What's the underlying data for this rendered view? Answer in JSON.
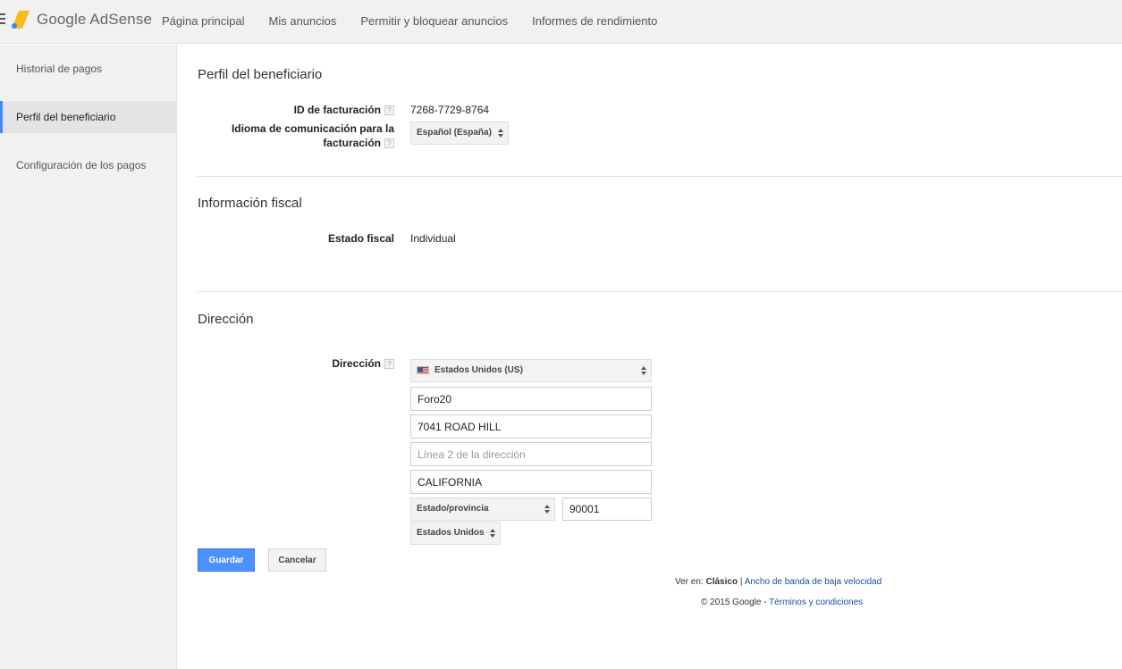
{
  "app": {
    "brand": "Google AdSense",
    "accent_color": "#4285f4"
  },
  "nav": {
    "items": [
      "Página principal",
      "Mis anuncios",
      "Permitir y bloquear anuncios",
      "Informes de rendimiento"
    ]
  },
  "sidebar": {
    "items": [
      {
        "label": "Historial de pagos"
      },
      {
        "label": "Perfil del beneficiario"
      },
      {
        "label": "Configuración de los pagos"
      }
    ],
    "active": "Perfil del beneficiario"
  },
  "profile": {
    "title": "Perfil del beneficiario",
    "billing_id_label": "ID de facturación",
    "billing_id": "7268-7729-8764",
    "language_label_line1": "Idioma de comunicación para la",
    "language_label_line2": "facturación",
    "language_value": "Español (España)"
  },
  "tax": {
    "title": "Información fiscal",
    "status_label": "Estado fiscal",
    "status_value": "Individual"
  },
  "address": {
    "title": "Dirección",
    "label": "Dirección",
    "country": "Estados Unidos (US)",
    "name": "Foro20",
    "line1": "7041 ROAD HILL",
    "line2_placeholder": "Línea 2 de la dirección",
    "city": "CALIFORNIA",
    "state_placeholder": "Estado/provincia",
    "zip": "90001",
    "country_select": "Estados Unidos"
  },
  "actions": {
    "save": "Guardar",
    "cancel": "Cancelar"
  },
  "footer": {
    "view_in": "Ver en:",
    "classic": "Clásico",
    "separator": "|",
    "low_bandwidth": "Ancho de banda de baja velocidad",
    "copyright": "© 2015 Google -",
    "terms": "Términos y condiciones"
  },
  "help_glyph": "?",
  "icons": [
    "menu-icon",
    "adsense-logo-icon",
    "help-icon",
    "us-flag-icon",
    "select-arrows-icon"
  ]
}
